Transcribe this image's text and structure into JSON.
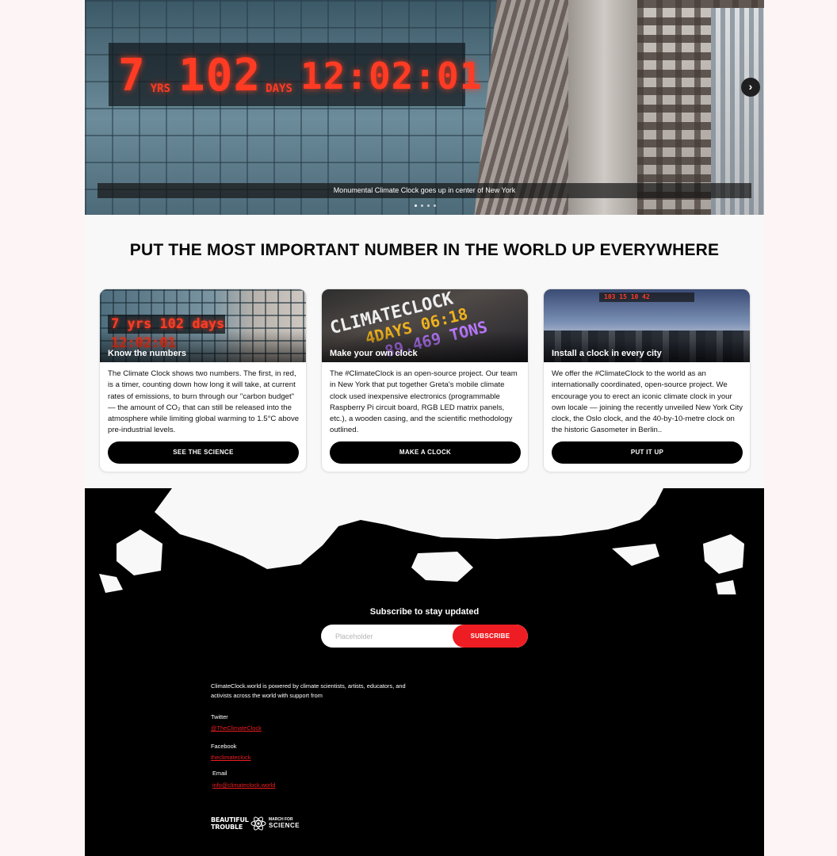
{
  "hero": {
    "clock": {
      "years": "7",
      "years_unit": "YRS",
      "days": "102",
      "days_unit": "DAYS",
      "time": "12:02:01"
    },
    "caption": "Monumental Climate Clock goes up in center of New York",
    "next_icon": "chevron-right-icon",
    "dots": 4,
    "active_dot": 0
  },
  "headline": "PUT THE MOST IMPORTANT NUMBER IN THE WORLD UP EVERYWHERE",
  "cards": [
    {
      "title": "Know the numbers",
      "body": "The Climate Clock shows two numbers. The first, in red, is a timer, counting down how long it will take, at current rates of emissions, to burn through our \"carbon budget\" — the amount of CO₂ that can still be released into the atmosphere while limiting global warming to 1.5°C above pre-industrial levels.",
      "button": "SEE THE SCIENCE",
      "image_text": "7 yrs 102 days 12:02:01"
    },
    {
      "title": "Make your own clock",
      "body": "The #ClimateClock is an open-source project. Our team in New York that put together Greta's mobile climate clock used inexpensive electronics (programmable Raspberry Pi circuit board, RGB LED matrix panels, etc.), a wooden casing, and the scientific methodology outlined.",
      "button": "MAKE A CLOCK",
      "image_lines": [
        "CLIMATECLOCK",
        "4DAYS 06:18",
        "89,469 TONS"
      ]
    },
    {
      "title": "Install a clock in every city",
      "body": "We offer the #ClimateClock to the world as an internationally coordinated, open-source project. We encourage you to erect an iconic climate clock in your own locale — joining the recently unveiled New York City clock, the Oslo clock, and the 40-by-10-metre clock on the historic Gasometer in Berlin..",
      "button": "PUT IT UP",
      "image_text": "103 15 10 42"
    }
  ],
  "subscribe": {
    "title": "Subscribe to stay updated",
    "placeholder": "Placeholder",
    "button": "SUBSCRIBE"
  },
  "footer": {
    "powered_by": "ClimateClock.world is powered by climate scientists, artists, educators, and activists across the world with support from",
    "links": [
      {
        "label": "Twitter",
        "value": "@TheClimateClock"
      },
      {
        "label": "Facebook",
        "value": "theclimateclock"
      },
      {
        "label": "Email",
        "value": "info@climateclock.world"
      }
    ],
    "logo_bt": [
      "BEAUTIFUL",
      "TROUBLE"
    ],
    "logo_ms": [
      "MARCH FOR",
      "SCIENCE"
    ]
  },
  "colors": {
    "accent": "#ee1d23",
    "clock_red": "#ff3b24",
    "footer_bg": "#000000"
  }
}
